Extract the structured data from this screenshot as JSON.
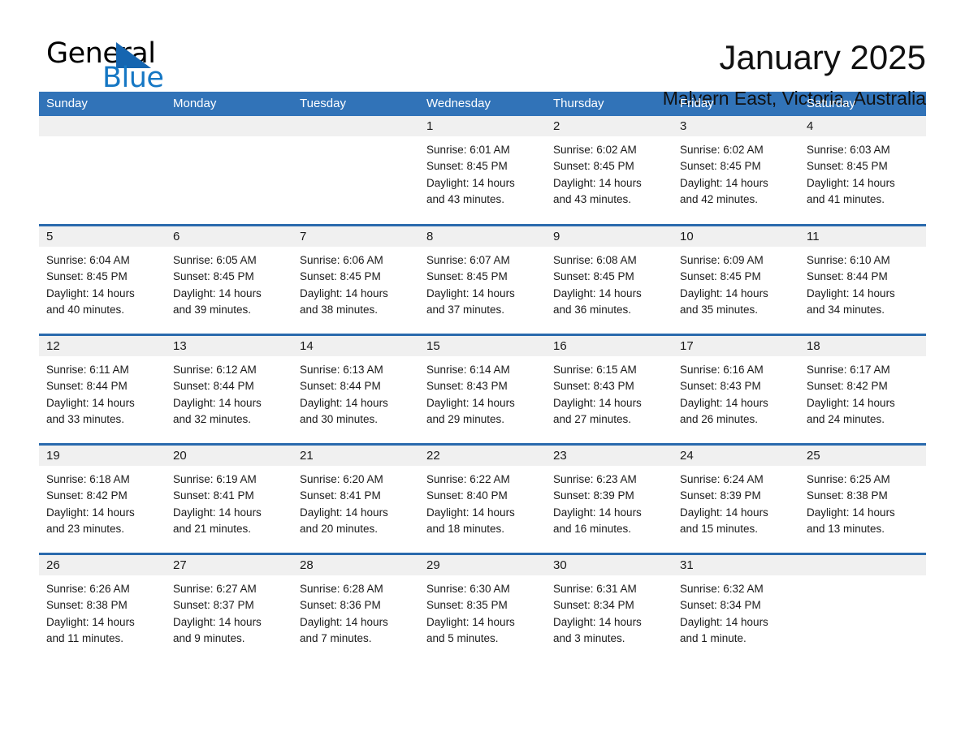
{
  "logo": {
    "text_primary": "General",
    "text_secondary": "Blue",
    "triangle_icon": "triangle-icon",
    "color_primary": "#000000",
    "color_secondary": "#1577c4",
    "color_triangle": "#1565b0"
  },
  "header": {
    "title": "January 2025",
    "subtitle": "Malvern East, Victoria, Australia"
  },
  "theme": {
    "header_blue": "#3173b8",
    "row_rule_blue": "#2a6aad",
    "daynum_band": "#f0f0f0",
    "page_bg": "#ffffff"
  },
  "weekday_headers": [
    "Sunday",
    "Monday",
    "Tuesday",
    "Wednesday",
    "Thursday",
    "Friday",
    "Saturday"
  ],
  "weeks": [
    [
      {
        "day": "",
        "lines": []
      },
      {
        "day": "",
        "lines": []
      },
      {
        "day": "",
        "lines": []
      },
      {
        "day": "1",
        "lines": [
          "Sunrise: 6:01 AM",
          "Sunset: 8:45 PM",
          "Daylight: 14 hours",
          "and 43 minutes."
        ]
      },
      {
        "day": "2",
        "lines": [
          "Sunrise: 6:02 AM",
          "Sunset: 8:45 PM",
          "Daylight: 14 hours",
          "and 43 minutes."
        ]
      },
      {
        "day": "3",
        "lines": [
          "Sunrise: 6:02 AM",
          "Sunset: 8:45 PM",
          "Daylight: 14 hours",
          "and 42 minutes."
        ]
      },
      {
        "day": "4",
        "lines": [
          "Sunrise: 6:03 AM",
          "Sunset: 8:45 PM",
          "Daylight: 14 hours",
          "and 41 minutes."
        ]
      }
    ],
    [
      {
        "day": "5",
        "lines": [
          "Sunrise: 6:04 AM",
          "Sunset: 8:45 PM",
          "Daylight: 14 hours",
          "and 40 minutes."
        ]
      },
      {
        "day": "6",
        "lines": [
          "Sunrise: 6:05 AM",
          "Sunset: 8:45 PM",
          "Daylight: 14 hours",
          "and 39 minutes."
        ]
      },
      {
        "day": "7",
        "lines": [
          "Sunrise: 6:06 AM",
          "Sunset: 8:45 PM",
          "Daylight: 14 hours",
          "and 38 minutes."
        ]
      },
      {
        "day": "8",
        "lines": [
          "Sunrise: 6:07 AM",
          "Sunset: 8:45 PM",
          "Daylight: 14 hours",
          "and 37 minutes."
        ]
      },
      {
        "day": "9",
        "lines": [
          "Sunrise: 6:08 AM",
          "Sunset: 8:45 PM",
          "Daylight: 14 hours",
          "and 36 minutes."
        ]
      },
      {
        "day": "10",
        "lines": [
          "Sunrise: 6:09 AM",
          "Sunset: 8:45 PM",
          "Daylight: 14 hours",
          "and 35 minutes."
        ]
      },
      {
        "day": "11",
        "lines": [
          "Sunrise: 6:10 AM",
          "Sunset: 8:44 PM",
          "Daylight: 14 hours",
          "and 34 minutes."
        ]
      }
    ],
    [
      {
        "day": "12",
        "lines": [
          "Sunrise: 6:11 AM",
          "Sunset: 8:44 PM",
          "Daylight: 14 hours",
          "and 33 minutes."
        ]
      },
      {
        "day": "13",
        "lines": [
          "Sunrise: 6:12 AM",
          "Sunset: 8:44 PM",
          "Daylight: 14 hours",
          "and 32 minutes."
        ]
      },
      {
        "day": "14",
        "lines": [
          "Sunrise: 6:13 AM",
          "Sunset: 8:44 PM",
          "Daylight: 14 hours",
          "and 30 minutes."
        ]
      },
      {
        "day": "15",
        "lines": [
          "Sunrise: 6:14 AM",
          "Sunset: 8:43 PM",
          "Daylight: 14 hours",
          "and 29 minutes."
        ]
      },
      {
        "day": "16",
        "lines": [
          "Sunrise: 6:15 AM",
          "Sunset: 8:43 PM",
          "Daylight: 14 hours",
          "and 27 minutes."
        ]
      },
      {
        "day": "17",
        "lines": [
          "Sunrise: 6:16 AM",
          "Sunset: 8:43 PM",
          "Daylight: 14 hours",
          "and 26 minutes."
        ]
      },
      {
        "day": "18",
        "lines": [
          "Sunrise: 6:17 AM",
          "Sunset: 8:42 PM",
          "Daylight: 14 hours",
          "and 24 minutes."
        ]
      }
    ],
    [
      {
        "day": "19",
        "lines": [
          "Sunrise: 6:18 AM",
          "Sunset: 8:42 PM",
          "Daylight: 14 hours",
          "and 23 minutes."
        ]
      },
      {
        "day": "20",
        "lines": [
          "Sunrise: 6:19 AM",
          "Sunset: 8:41 PM",
          "Daylight: 14 hours",
          "and 21 minutes."
        ]
      },
      {
        "day": "21",
        "lines": [
          "Sunrise: 6:20 AM",
          "Sunset: 8:41 PM",
          "Daylight: 14 hours",
          "and 20 minutes."
        ]
      },
      {
        "day": "22",
        "lines": [
          "Sunrise: 6:22 AM",
          "Sunset: 8:40 PM",
          "Daylight: 14 hours",
          "and 18 minutes."
        ]
      },
      {
        "day": "23",
        "lines": [
          "Sunrise: 6:23 AM",
          "Sunset: 8:39 PM",
          "Daylight: 14 hours",
          "and 16 minutes."
        ]
      },
      {
        "day": "24",
        "lines": [
          "Sunrise: 6:24 AM",
          "Sunset: 8:39 PM",
          "Daylight: 14 hours",
          "and 15 minutes."
        ]
      },
      {
        "day": "25",
        "lines": [
          "Sunrise: 6:25 AM",
          "Sunset: 8:38 PM",
          "Daylight: 14 hours",
          "and 13 minutes."
        ]
      }
    ],
    [
      {
        "day": "26",
        "lines": [
          "Sunrise: 6:26 AM",
          "Sunset: 8:38 PM",
          "Daylight: 14 hours",
          "and 11 minutes."
        ]
      },
      {
        "day": "27",
        "lines": [
          "Sunrise: 6:27 AM",
          "Sunset: 8:37 PM",
          "Daylight: 14 hours",
          "and 9 minutes."
        ]
      },
      {
        "day": "28",
        "lines": [
          "Sunrise: 6:28 AM",
          "Sunset: 8:36 PM",
          "Daylight: 14 hours",
          "and 7 minutes."
        ]
      },
      {
        "day": "29",
        "lines": [
          "Sunrise: 6:30 AM",
          "Sunset: 8:35 PM",
          "Daylight: 14 hours",
          "and 5 minutes."
        ]
      },
      {
        "day": "30",
        "lines": [
          "Sunrise: 6:31 AM",
          "Sunset: 8:34 PM",
          "Daylight: 14 hours",
          "and 3 minutes."
        ]
      },
      {
        "day": "31",
        "lines": [
          "Sunrise: 6:32 AM",
          "Sunset: 8:34 PM",
          "Daylight: 14 hours",
          "and 1 minute."
        ]
      },
      {
        "day": "",
        "lines": []
      }
    ]
  ]
}
